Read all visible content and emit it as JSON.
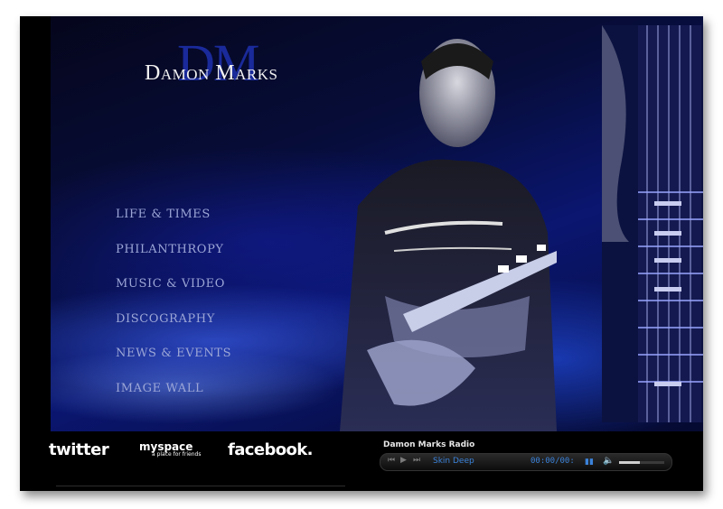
{
  "logo": {
    "monogram": "DM",
    "name": "Damon Marks"
  },
  "nav": [
    "LIFE & TIMES",
    "PHILANTHROPY",
    "MUSIC & VIDEO",
    "DISCOGRAPHY",
    "NEWS & EVENTS",
    "IMAGE WALL"
  ],
  "social": {
    "twitter": "twitter",
    "myspace": "myspace",
    "myspace_tagline": "a place for friends",
    "facebook": "facebook."
  },
  "radio": {
    "title": "Damon Marks Radio",
    "track": "Skin Deep",
    "time": "00:00/00:",
    "volume_level": 0.45
  },
  "colors": {
    "nav_text": "#9ca6d6",
    "player_accent": "#3b82d9",
    "background": "#000000",
    "stage_blue": "#0a1670"
  },
  "icons": {
    "prev": "skip-back-icon",
    "play": "play-icon",
    "next": "skip-forward-icon",
    "eq": "equalizer-icon",
    "volume": "speaker-icon"
  }
}
